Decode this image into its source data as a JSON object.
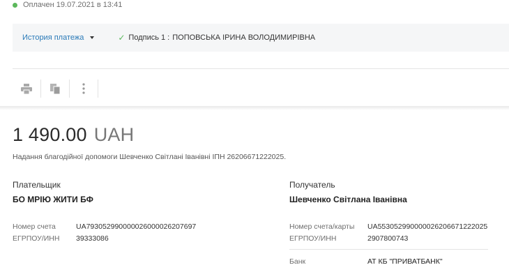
{
  "status": {
    "text": "Оплачен 19.07.2021 в 13:41",
    "color": "#5cb85c"
  },
  "history": {
    "link_label": "История платежа",
    "signature_label": "Подпись 1 :",
    "signature_name": "ПОПОВСЬКА ІРИНА ВОЛОДИМИРІВНА"
  },
  "toolbar": {
    "icons": [
      "print-icon",
      "copy-icon",
      "more-icon"
    ]
  },
  "payment": {
    "amount": "1 490.00",
    "currency": "UAH",
    "purpose": "Надання благодійної допомоги Шевченко Світлані Іванівні ІПН 2620667122202​5."
  },
  "payer": {
    "role": "Плательщик",
    "name": "БО МРІЮ ЖИТИ БФ",
    "account_label": "Номер счета",
    "account": "UA793052990000026000026207697",
    "code_label": "ЕГРПОУ/ИНН",
    "code": "39333086"
  },
  "recipient": {
    "role": "Получатель",
    "name": "Шевченко Світлана Іванівна",
    "account_label": "Номер счета/карты",
    "account": "UA553052990000026206671222025",
    "code_label": "ЕГРПОУ/ИНН",
    "code": "2907800743",
    "bank_label": "Банк",
    "bank": "АТ КБ \"ПРИВАТБАНК\""
  },
  "colors": {
    "link": "#2a7ab8",
    "success": "#5cb85c"
  }
}
